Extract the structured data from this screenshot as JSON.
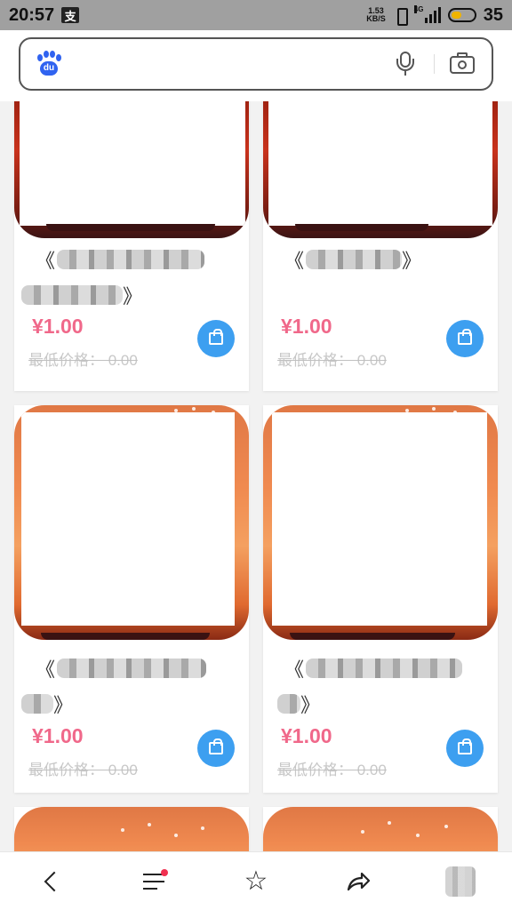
{
  "status_bar": {
    "time": "20:57",
    "app_badge": "支",
    "net_speed_value": "1.53",
    "net_speed_unit": "KB/S",
    "network": "4G",
    "battery": "35"
  },
  "search": {
    "placeholder": "",
    "logo_text": "du"
  },
  "products": [
    {
      "title_prefix": "《",
      "title_suffix": "》",
      "price": "¥1.00",
      "min_price": "最低价格： 0.00"
    },
    {
      "title_prefix": "《",
      "title_suffix": "》",
      "price": "¥1.00",
      "min_price": "最低价格： 0.00"
    },
    {
      "title_prefix": "《",
      "title_suffix": "》",
      "price": "¥1.00",
      "min_price": "最低价格： 0.00"
    },
    {
      "title_prefix": "《",
      "title_suffix": "》",
      "price": "¥1.00",
      "min_price": "最低价格： 0.00"
    }
  ],
  "icons": {
    "cart": "shopping-bag-icon",
    "back": "chevron-left-icon",
    "menu": "menu-icon",
    "favorite": "star-icon",
    "share": "share-icon"
  },
  "colors": {
    "price": "#f0688a",
    "cart_button": "#3d9ff0",
    "status_bar": "#a0a0a0"
  }
}
